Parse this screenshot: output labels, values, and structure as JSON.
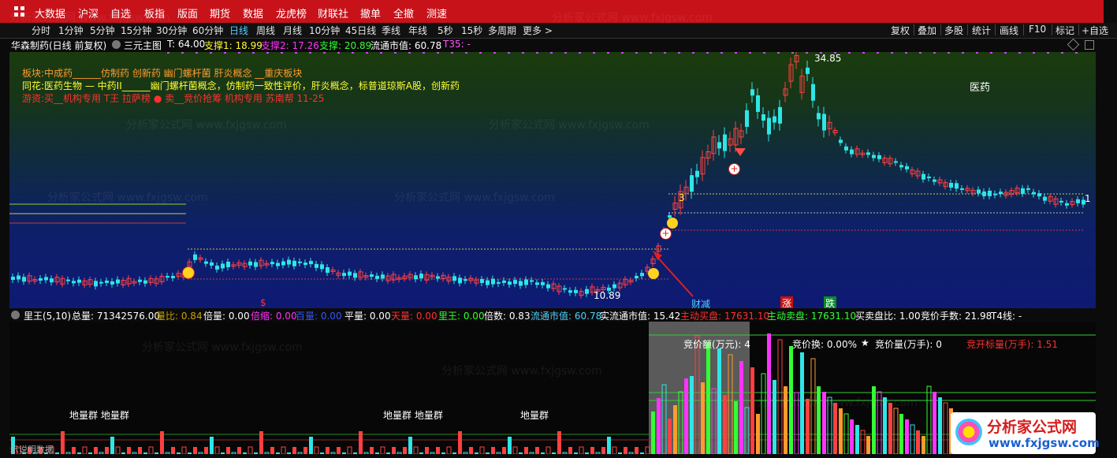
{
  "colors": {
    "menu_bg": "#c8121a",
    "up": "#ff4040",
    "down": "#2ee6e6",
    "active_tab": "#4fd0ff",
    "support1": "#ffff33",
    "support2": "#ff33ff",
    "support3": "#33ff33"
  },
  "menu": [
    "大数据",
    "沪深",
    "自选",
    "板指",
    "版面",
    "期货",
    "数据",
    "龙虎榜",
    "财联社",
    "撤单",
    "全撤",
    "测速"
  ],
  "periods": [
    "分时",
    "1分钟",
    "5分钟",
    "15分钟",
    "30分钟",
    "60分钟",
    "日线",
    "周线",
    "月线",
    "10分钟",
    "45日线",
    "季线",
    "年线",
    "5秒",
    "15秒",
    "多周期",
    "更多 >"
  ],
  "active_period": "日线",
  "right_buttons": [
    "复权",
    "叠加",
    "多股",
    "统计",
    "画线",
    "F10",
    "标记",
    "+自选"
  ],
  "info": {
    "stock": "华森制药(日线 前复权)",
    "chart_mode": "三元主图",
    "t": "T: 64.00",
    "support1": "支撑1: 18.99",
    "support2": "支撑2: 17.26",
    "support3": "支撑: 20.89",
    "mkt_cap": "流通市值: 60.78",
    "t35": "T35: -"
  },
  "overlay": {
    "sector": "板块:中成药______仿制药 创新药 幽门螺杆菌 肝炎概念 __重庆板块",
    "tonghuashun": "同花:医药生物 — 中药II______幽门螺杆菌概念，仿制药一致性评价，肝炎概念，标普道琼斯A股，创新药",
    "hot_money": "游资:买__机构专用 T王 拉萨榜 ● 卖__竞价抢筹 机构专用 苏南帮   11-25",
    "sector_tag": "医药",
    "high_label": "34.85",
    "low_label": "10.89",
    "marker_3": "3",
    "marker_1": "1",
    "bottom_s": "$",
    "signal_cai": "财减",
    "signal_zhang": "涨",
    "signal_die": "跌"
  },
  "vol_info": {
    "title": "里王(5,10)",
    "total": "总量: 71342576.00",
    "liangbi": "量比: 0.84",
    "beiliang": "倍量: 0.00",
    "beisuo": "倍缩: 0.00",
    "baiyin": "百量: 0.00",
    "pingliang": "平量: 0.00",
    "tianliang": "天量: 0.00",
    "liwang": "里王: 0.00",
    "beishu": "倍数: 0.83",
    "mkt_cap": "流通市值: 60.78",
    "real_mkt_cap": "实流通市值: 15.42",
    "buy": "主动买盘: 17631.10",
    "sell": "主动卖盘: 17631.10",
    "ratio": "买卖盘比: 1.00",
    "auction_lots": "竞价手数: 21.98",
    "t4": "T4线: -"
  },
  "auction": {
    "amount": "竞价额(万元): 4",
    "change": "竞价换: 0.00%",
    "star": "★",
    "volume": "竞价量(万手): 0",
    "open_ratio": "竞开标量(万手): 1.51"
  },
  "ground_labels": [
    "地量群 地量群",
    "地量群 地量群",
    "地量群"
  ],
  "watermark": "分析家公式网 www.fxjgsw.com",
  "logo": {
    "text": "分析家公式网",
    "url": "www.fxjgsw.com"
  },
  "bottom_left": "图示说明数据"
}
